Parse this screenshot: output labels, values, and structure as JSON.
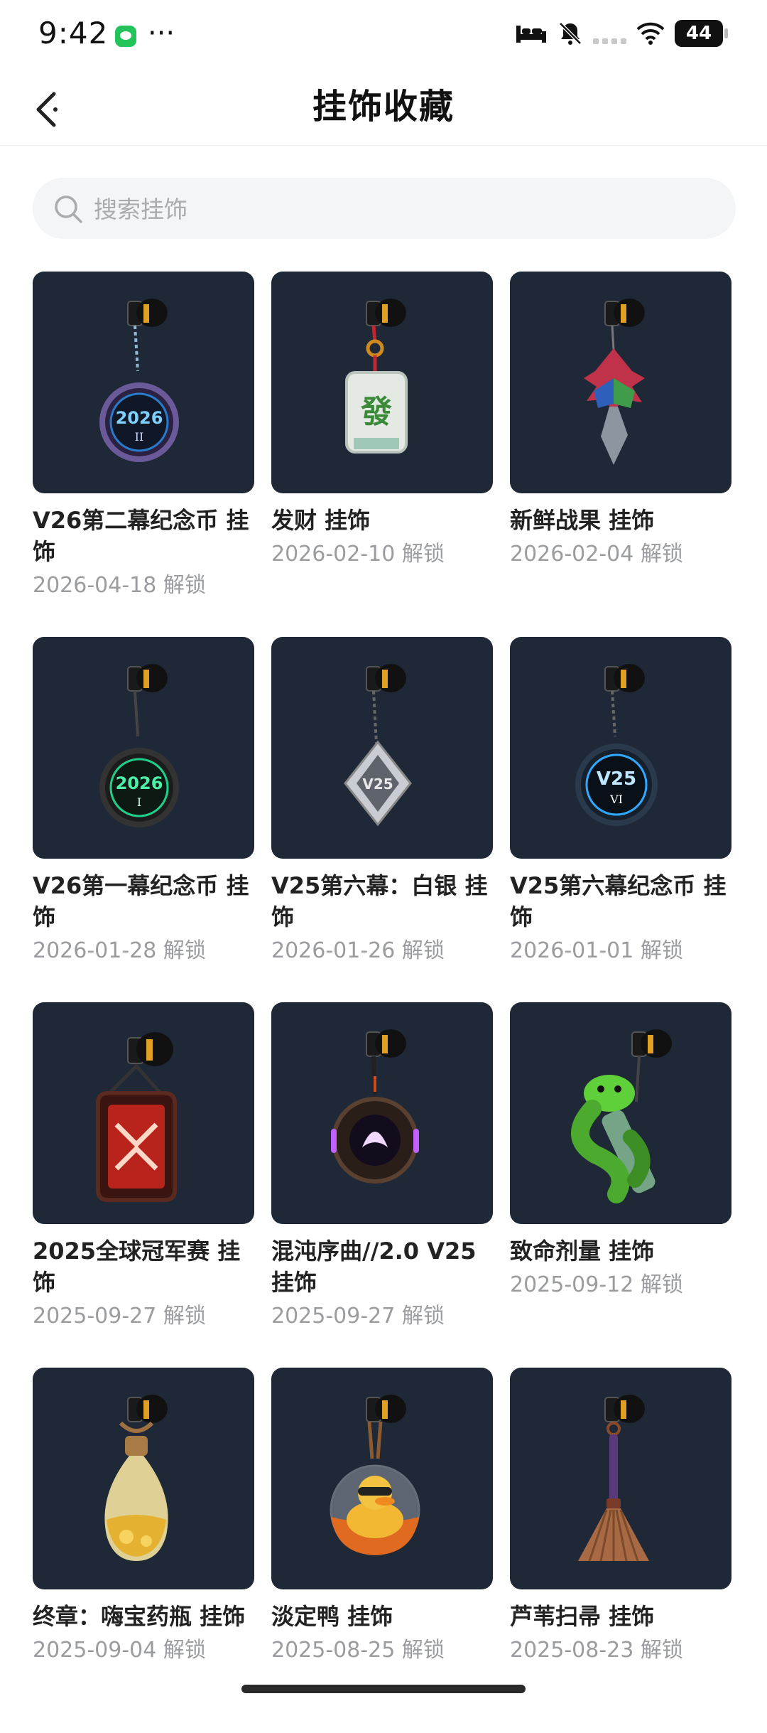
{
  "status_bar": {
    "time": "9:42",
    "more": "···",
    "battery": "44"
  },
  "header": {
    "title": "挂饰收藏"
  },
  "search": {
    "placeholder": "搜索挂饰"
  },
  "items": [
    {
      "name": "V26第二幕纪念币 挂饰",
      "date": "2026-04-18 解锁",
      "icon": "coin-2026-II-icon",
      "art": {
        "coin_text": "2026",
        "coin_sub": "II"
      }
    },
    {
      "name": "发财 挂饰",
      "date": "2026-02-10 解锁",
      "icon": "mahjong-tile-icon",
      "art": {
        "tile_char": "發"
      }
    },
    {
      "name": "新鲜战果 挂饰",
      "date": "2026-02-04 解锁",
      "icon": "leaf-sword-icon"
    },
    {
      "name": "V26第一幕纪念币 挂饰",
      "date": "2026-01-28 解锁",
      "icon": "coin-2026-I-icon",
      "art": {
        "coin_text": "2026",
        "coin_sub": "I"
      }
    },
    {
      "name": "V25第六幕：白银 挂饰",
      "date": "2026-01-26 解锁",
      "icon": "silver-diamond-icon",
      "art": {
        "diamond_text": "V25"
      }
    },
    {
      "name": "V25第六幕纪念币 挂饰",
      "date": "2026-01-01 解锁",
      "icon": "coin-v25-VI-icon",
      "art": {
        "coin_text": "V25",
        "coin_sub": "VI"
      }
    },
    {
      "name": "2025全球冠军赛 挂饰",
      "date": "2025-09-27 解锁",
      "icon": "champions-tag-icon"
    },
    {
      "name": "混沌序曲//2.0 V25 挂饰",
      "date": "2025-09-27 解锁",
      "icon": "orb-device-icon"
    },
    {
      "name": "致命剂量 挂饰",
      "date": "2025-09-12 解锁",
      "icon": "snake-vial-icon"
    },
    {
      "name": "终章：嗨宝药瓶 挂饰",
      "date": "2025-09-04 解锁",
      "icon": "potion-bottle-icon"
    },
    {
      "name": "淡定鸭 挂饰",
      "date": "2025-08-25 解锁",
      "icon": "duck-capsule-icon"
    },
    {
      "name": "芦苇扫帚 挂饰",
      "date": "2025-08-23 解锁",
      "icon": "broom-icon"
    }
  ]
}
